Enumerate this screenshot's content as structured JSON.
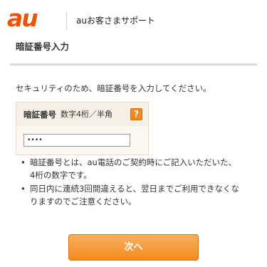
{
  "header": {
    "logo_text": "au",
    "support_title": "auお客さまサポート"
  },
  "section": {
    "title": "暗証番号入力"
  },
  "intro_text": "セキュリティのため、暗証番号を入力してください。",
  "pin_form": {
    "label": "暗証番号",
    "hint": "数字4桁／半角",
    "help_label": "?",
    "value": "••••"
  },
  "notes": [
    {
      "line1": "暗証番号とは、au電話のご契約時にご記入いただいた、",
      "line2": "4桁の数字です。"
    },
    {
      "line1": "同日内に連続3回間違えると、翌日までご利用できなくな",
      "line2": "りますのでご注意ください。"
    }
  ],
  "next_button": {
    "label": "次へ"
  },
  "colors": {
    "accent": "#ea5504",
    "button": "#f18a22"
  }
}
